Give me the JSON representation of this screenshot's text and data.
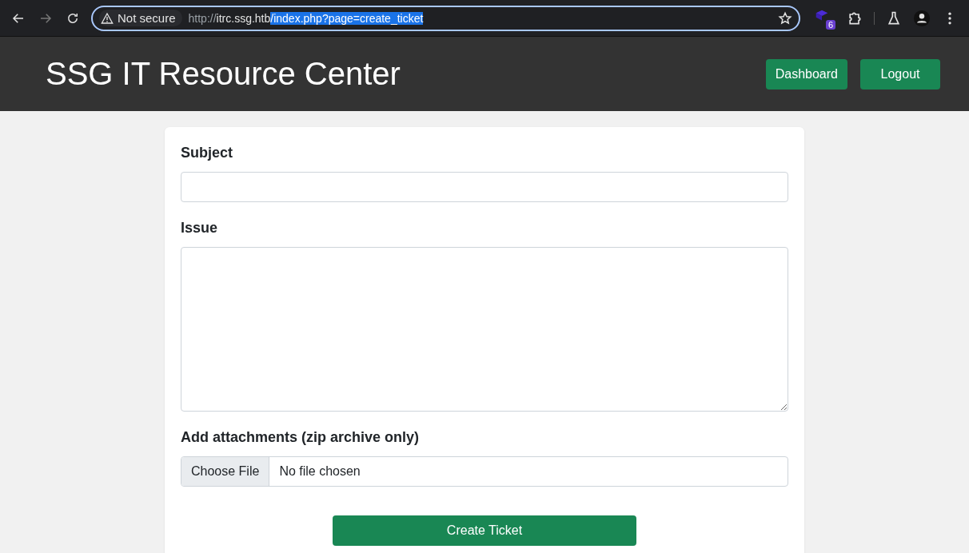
{
  "browser": {
    "security_label": "Not secure",
    "url_scheme": "http://",
    "url_host": "itrc.ssg.htb",
    "url_path": "/index.php?page=create_ticket",
    "url_path_selected": true,
    "extension_badge": "6"
  },
  "header": {
    "title": "SSG IT Resource Center",
    "buttons": [
      "Dashboard",
      "Logout"
    ]
  },
  "form": {
    "fields": [
      {
        "kind": "input",
        "label": "Subject"
      },
      {
        "kind": "textarea",
        "label": "Issue"
      },
      {
        "kind": "file",
        "label": "Add attachments (zip archive only)",
        "button": "Choose File",
        "status": "No file chosen"
      }
    ],
    "submit": "Create Ticket"
  }
}
